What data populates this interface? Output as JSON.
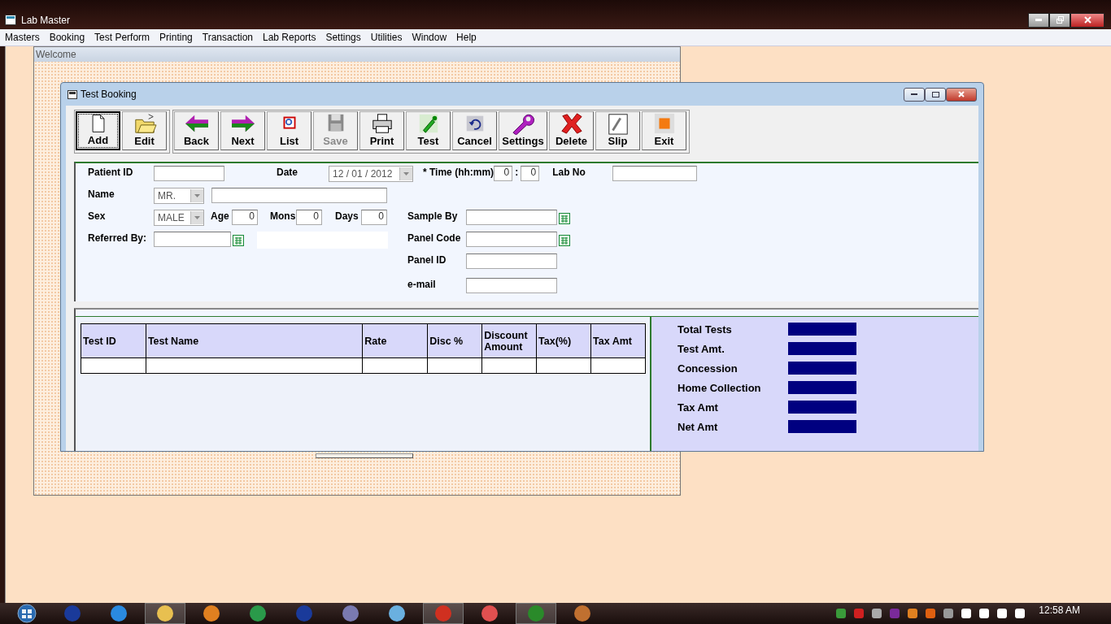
{
  "window": {
    "title": "Lab Master"
  },
  "menu": [
    "Masters",
    "Booking",
    "Test Perform",
    "Printing",
    "Transaction",
    "Lab Reports",
    "Settings",
    "Utilities",
    "Window",
    "Help"
  ],
  "welcome": {
    "title": "Welcome"
  },
  "booking": {
    "title": "Test Booking",
    "toolbar": [
      {
        "kind": "add",
        "label": "Add",
        "focused": true,
        "disabled": false
      },
      {
        "kind": "edit",
        "label": "Edit",
        "focused": false,
        "disabled": false
      },
      {
        "kind": "back",
        "label": "Back",
        "focused": false,
        "disabled": false
      },
      {
        "kind": "next",
        "label": "Next",
        "focused": false,
        "disabled": false
      },
      {
        "kind": "list",
        "label": "List",
        "focused": false,
        "disabled": false
      },
      {
        "kind": "save",
        "label": "Save",
        "focused": false,
        "disabled": true
      },
      {
        "kind": "print",
        "label": "Print",
        "focused": false,
        "disabled": false
      },
      {
        "kind": "test",
        "label": "Test",
        "focused": false,
        "disabled": false
      },
      {
        "kind": "cancel",
        "label": "Cancel",
        "focused": false,
        "disabled": false
      },
      {
        "kind": "settings",
        "label": "Settings",
        "focused": false,
        "disabled": false
      },
      {
        "kind": "delete",
        "label": "Delete",
        "focused": false,
        "disabled": false
      },
      {
        "kind": "slip",
        "label": "Slip",
        "focused": false,
        "disabled": false
      },
      {
        "kind": "exit",
        "label": "Exit",
        "focused": false,
        "disabled": false
      }
    ],
    "form": {
      "patient_id": {
        "label": "Patient ID"
      },
      "date": {
        "label": "Date",
        "value": "12 / 01 / 2012"
      },
      "time": {
        "label": "* Time (hh:mm)",
        "hour": "0",
        "separator": ":",
        "minute": "0"
      },
      "lab_no": {
        "label": "Lab No"
      },
      "name": {
        "label": "Name",
        "title": "MR."
      },
      "sex": {
        "label": "Sex",
        "value": "MALE"
      },
      "age": {
        "label": "Age",
        "value": "0"
      },
      "mons": {
        "label": "Mons",
        "value": "0"
      },
      "days": {
        "label": "Days",
        "value": "0"
      },
      "referred_by": {
        "label": "Referred By:"
      },
      "sample_by": {
        "label": "Sample  By"
      },
      "panel_code": {
        "label": "Panel Code"
      },
      "panel_id": {
        "label": "Panel ID"
      },
      "email": {
        "label": "e-mail"
      }
    },
    "table": {
      "columns": [
        "Test ID",
        "Test Name",
        "Rate",
        "Disc %",
        "Discount Amount",
        "Tax(%)",
        "Tax Amt"
      ]
    },
    "summary": [
      "Total Tests",
      "Test Amt.",
      "Concession",
      "Home Collection",
      "Tax Amt",
      "Net Amt"
    ]
  },
  "taskbar": {
    "clock": "12:58 AM"
  }
}
